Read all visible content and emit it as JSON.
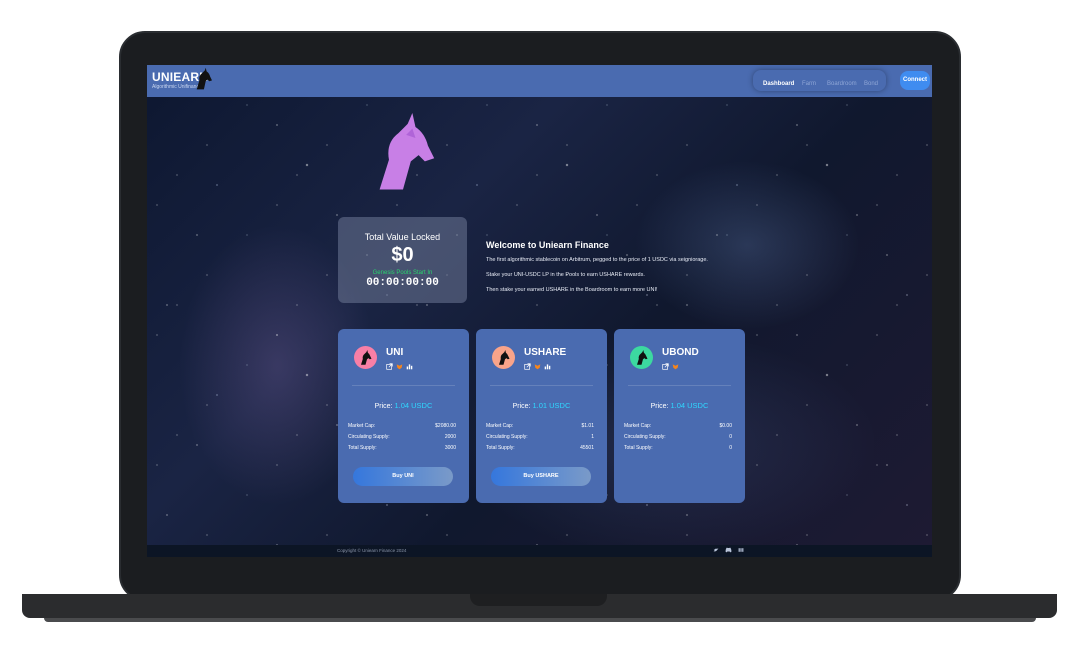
{
  "navbar": {
    "brand": "UNIEARN",
    "brand_subtitle": "Algorithmic Unifinance",
    "links": [
      "Dashboard",
      "Farm",
      "Boardroom",
      "Bond"
    ],
    "active_link": "Dashboard",
    "connect_label": "Connect"
  },
  "tvl": {
    "title": "Total Value Locked",
    "value": "$0",
    "epoch_label": "Genesis Pools Start In",
    "timer": "00:00:00:00"
  },
  "welcome": {
    "title": "Welcome to Uniearn Finance",
    "line1": "The first algorithmic stablecoin on Arbitrum, pegged to the price of 1 USDC via seigniorage.",
    "line2": "Stake your UNI-USDC LP in the Pools to earn USHARE rewards.",
    "line3": "Then stake your earned USHARE in the Boardroom to earn more UNI!"
  },
  "cards": [
    {
      "name": "UNI",
      "color": "#f87fa6",
      "price_label": "Price:",
      "price": "1.04 USDC",
      "market_cap_label": "Market Cap:",
      "market_cap": "$2080.00",
      "circ_label": "Circulating Supply:",
      "circ": "2000",
      "total_label": "Total Supply:",
      "total": "3000",
      "buy_label": "Buy UNI",
      "icons": [
        "external-link-icon",
        "metamask-icon",
        "chart-icon"
      ]
    },
    {
      "name": "USHARE",
      "color": "#f9a48a",
      "price_label": "Price:",
      "price": "1.01 USDC",
      "market_cap_label": "Market Cap:",
      "market_cap": "$1.01",
      "circ_label": "Circulating Supply:",
      "circ": "1",
      "total_label": "Total Supply:",
      "total": "45501",
      "buy_label": "Buy USHARE",
      "icons": [
        "external-link-icon",
        "metamask-icon",
        "chart-icon"
      ]
    },
    {
      "name": "UBOND",
      "color": "#3cd9a0",
      "price_label": "Price:",
      "price": "1.04 USDC",
      "market_cap_label": "Market Cap:",
      "market_cap": "$0.00",
      "circ_label": "Circulating Supply:",
      "circ": "0",
      "total_label": "Total Supply:",
      "total": "0",
      "icons": [
        "external-link-icon",
        "metamask-icon"
      ]
    }
  ],
  "footer": {
    "copyright": "Copyright © Uniearn Finance 2024",
    "icons": [
      "twitter-icon",
      "discord-icon",
      "medium-icon"
    ]
  },
  "colors": {
    "navbar": "#4a6bb0",
    "accent_price": "#2fd7ff",
    "epoch_green": "#29d36e",
    "unicorn": "#c87fe6"
  }
}
